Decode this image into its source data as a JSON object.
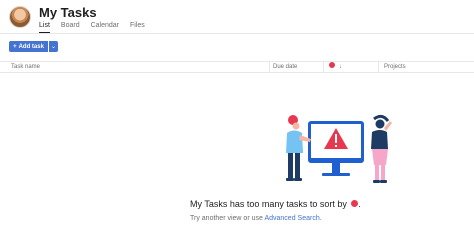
{
  "header": {
    "title": "My Tasks",
    "title_chevron": "⌄"
  },
  "tabs": [
    {
      "label": "List",
      "active": true
    },
    {
      "label": "Board",
      "active": false
    },
    {
      "label": "Calendar",
      "active": false
    },
    {
      "label": "Files",
      "active": false
    }
  ],
  "toolbar": {
    "add_task_plus": "+",
    "add_task_label": "Add task",
    "add_task_menu": "⌄"
  },
  "columns": {
    "task_name": "Task name",
    "due_date": "Due date",
    "sort_arrow": "↓",
    "projects": "Projects"
  },
  "empty_state": {
    "title_before": "My Tasks has too many tasks to sort by",
    "title_after": ".",
    "subtitle_before": "Try another view or use",
    "link_label": "Advanced Search",
    "subtitle_after": "."
  },
  "colors": {
    "accent": "#4573d2",
    "sort_icon": "#e8384f",
    "monitor": "#1f5fcf",
    "warning": "#e8384f"
  }
}
